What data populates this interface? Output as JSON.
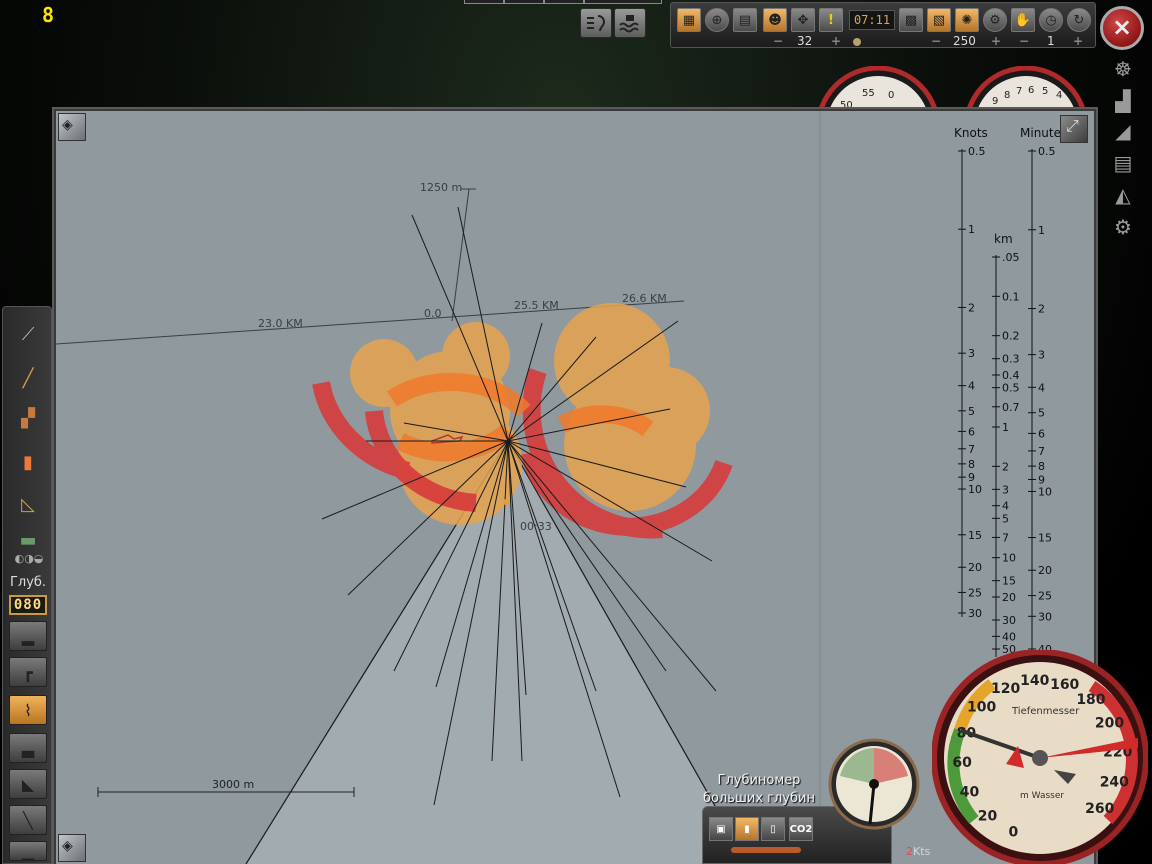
{
  "fps_indicator": "8",
  "toolbar": {
    "clock": "07:11",
    "time_compression": "32",
    "render_value": "250",
    "zoom_value": "1",
    "minus": "−",
    "plus": "+"
  },
  "close_button": "×",
  "map": {
    "range_label": "1250 m",
    "distance_labels": [
      "23.0 KM",
      "0.0",
      "25.5 KM",
      "26.6 KM"
    ],
    "time_label": "00:33",
    "scale_label": "3000 m",
    "ruler": {
      "knots_title": "Knots",
      "minutes_title": "Minutes",
      "km_title": "km",
      "knots_ticks": [
        "0.5",
        "1",
        "2",
        "3",
        "4",
        "5",
        "6",
        "7",
        "8",
        "9",
        "10",
        "15",
        "20",
        "25",
        "30"
      ],
      "minutes_ticks": [
        "0.5",
        "1",
        "2",
        "3",
        "4",
        "5",
        "6",
        "7",
        "8",
        "9",
        "10",
        "15",
        "20",
        "25",
        "30",
        "40"
      ],
      "km_ticks": [
        ".05",
        "0.1",
        "0.2",
        "0.3",
        "0.4",
        "0.5",
        "0.7",
        "1",
        "2",
        "3",
        "4",
        "5",
        "7",
        "10",
        "15",
        "20",
        "30",
        "40",
        "50"
      ]
    }
  },
  "left_panel": {
    "depth_label": "Глуб.",
    "depth_value": "080"
  },
  "gauges": {
    "depth_gauge_title": "Tiefenmesser",
    "depth_gauge_unit": "m Wasser",
    "depth_ticks": [
      "0",
      "20",
      "40",
      "60",
      "80",
      "100",
      "120",
      "140",
      "160",
      "180",
      "200",
      "220",
      "240",
      "260"
    ],
    "depth_reading_m": 80,
    "top_dial_a_ticks": [
      "50",
      "55",
      "0"
    ],
    "top_dial_b_ticks": [
      "9",
      "8",
      "7",
      "6",
      "5",
      "4"
    ]
  },
  "tooltip": "Глубиномер больших глубин",
  "hud": {
    "co2_label": "CO2",
    "speed_value": "2",
    "speed_unit": "Kts"
  },
  "colors": {
    "map_bg": "#8f999e",
    "contact_fill": "#e7a34d",
    "contact_ring": "#d63b3b",
    "accent_orange": "#f1b868"
  }
}
